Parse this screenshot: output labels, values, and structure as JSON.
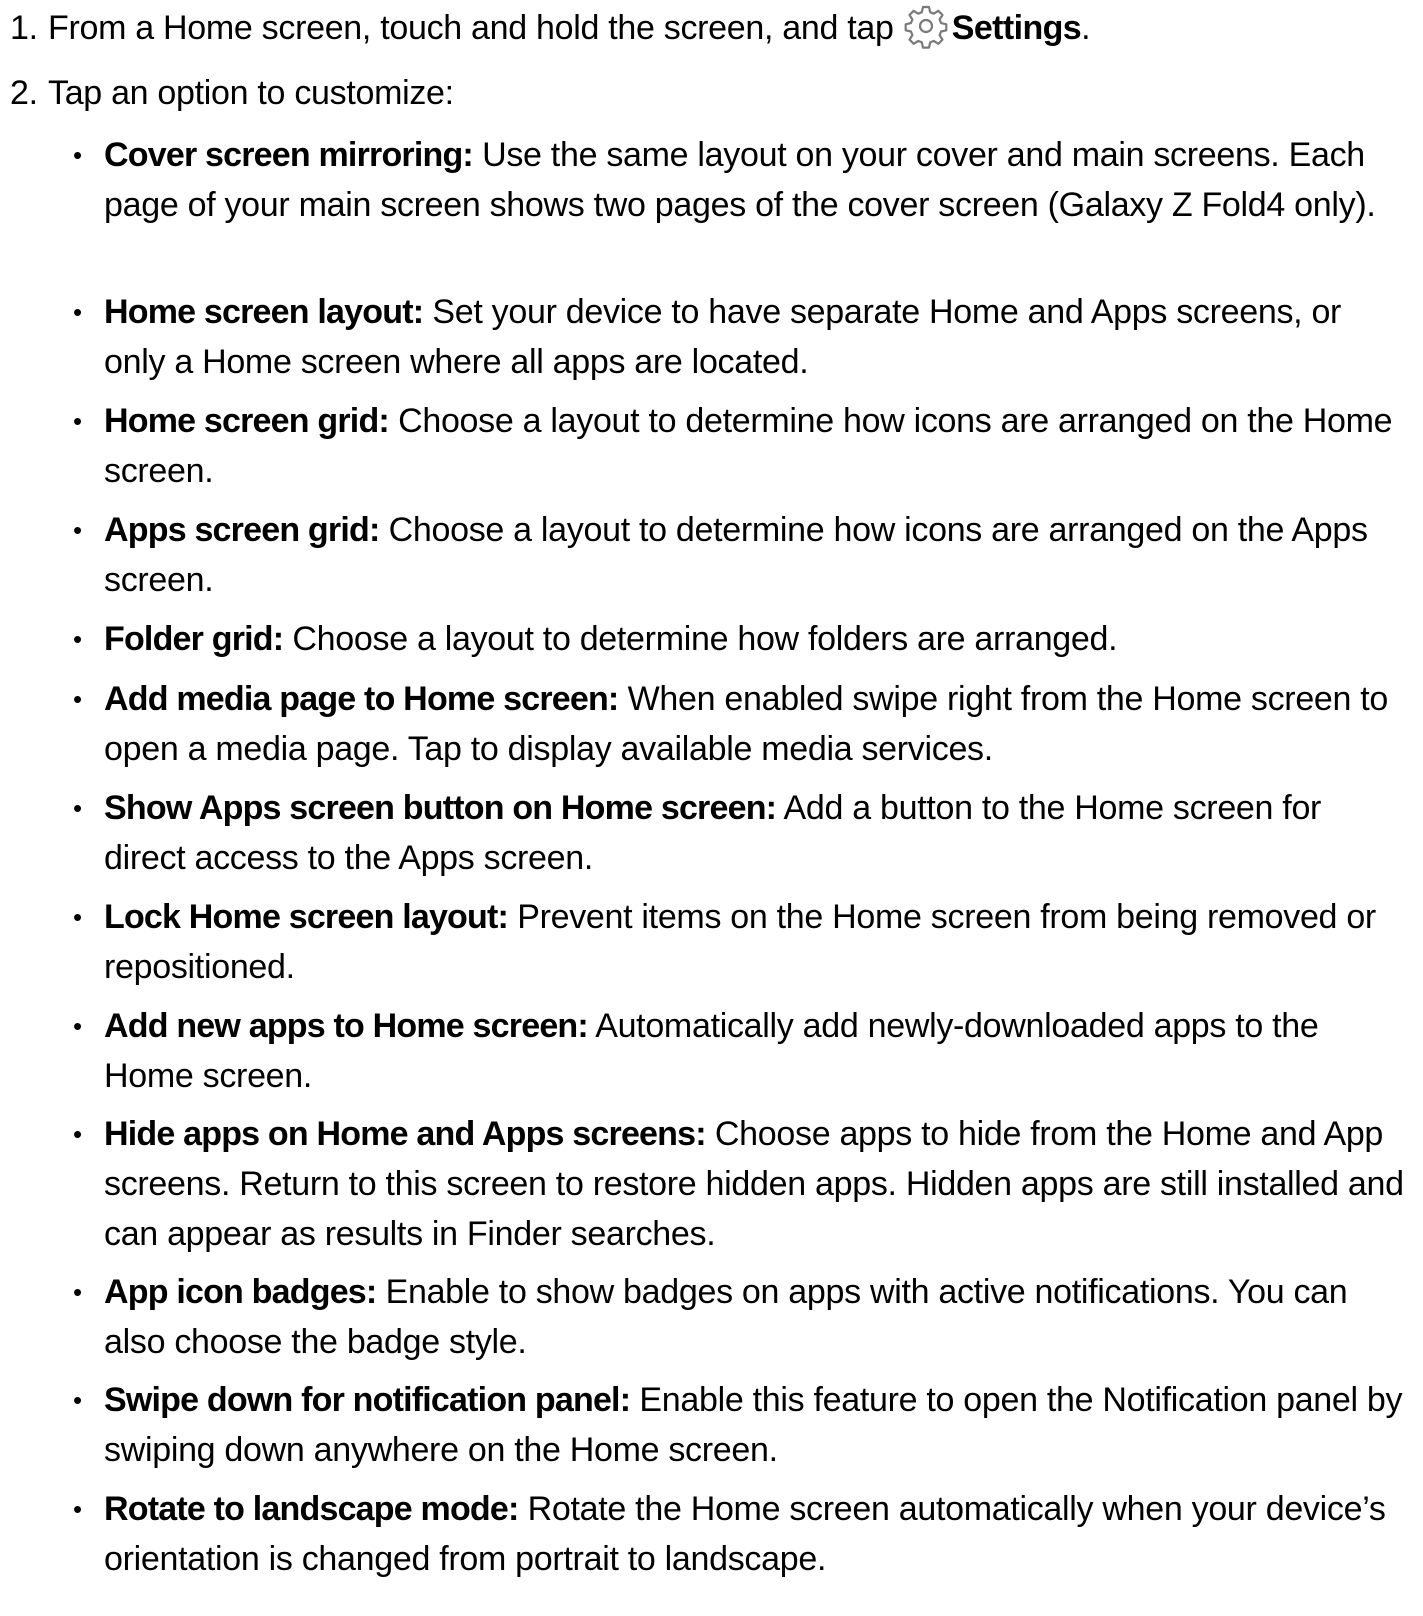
{
  "steps": [
    {
      "number": "1.",
      "text_before": "From a Home screen, touch and hold the screen, and tap",
      "icon": "gear-icon",
      "bold_text": "Settings",
      "text_after": "."
    },
    {
      "number": "2.",
      "text": "Tap an option to customize:"
    }
  ],
  "options": [
    {
      "term": "Cover screen mirroring:",
      "description": " Use the same layout on your cover and main screens. Each page of your main screen shows two pages of the cover screen (Galaxy Z Fold4 only)."
    },
    {
      "term": "Home screen layout:",
      "description": " Set your device to have separate Home and Apps screens, or only a Home screen where all apps are located."
    },
    {
      "term": "Home screen grid:",
      "description": " Choose a layout to determine how icons are arranged on the Home screen."
    },
    {
      "term": "Apps screen grid:",
      "description": " Choose a layout to determine how icons are arranged on the Apps screen."
    },
    {
      "term": "Folder grid:",
      "description": " Choose a layout to determine how folders are arranged."
    },
    {
      "term": "Add media page to Home screen:",
      "description": " When enabled swipe right from the Home screen to open a media page. Tap to display available media services."
    },
    {
      "term": "Show Apps screen button on Home screen:",
      "description": " Add a button to the Home screen for direct access to the Apps screen."
    },
    {
      "term": "Lock Home screen layout:",
      "description": " Prevent items on the Home screen from being removed or repositioned."
    },
    {
      "term": "Add new apps to Home screen:",
      "description": " Automatically add newly-downloaded apps to the Home screen."
    },
    {
      "term": "Hide apps on Home and Apps screens:",
      "description": " Choose apps to hide from the Home and App screens. Return to this screen to restore hidden apps. Hidden apps are still installed and can appear as results in Finder searches."
    },
    {
      "term": "App icon badges:",
      "description": " Enable to show badges on apps with active notifications. You can also choose the badge style."
    },
    {
      "term": "Swipe down for notification panel:",
      "description": " Enable this feature to open the Notification panel by swiping down anywhere on the Home screen."
    },
    {
      "term": "Rotate to landscape mode:",
      "description": " Rotate the Home screen automatically when your device’s orientation is changed from portrait to landscape."
    }
  ],
  "bullet_glyph": "•",
  "colors": {
    "text": "#000000",
    "icon": "#7a7a7a",
    "background": "#ffffff"
  }
}
